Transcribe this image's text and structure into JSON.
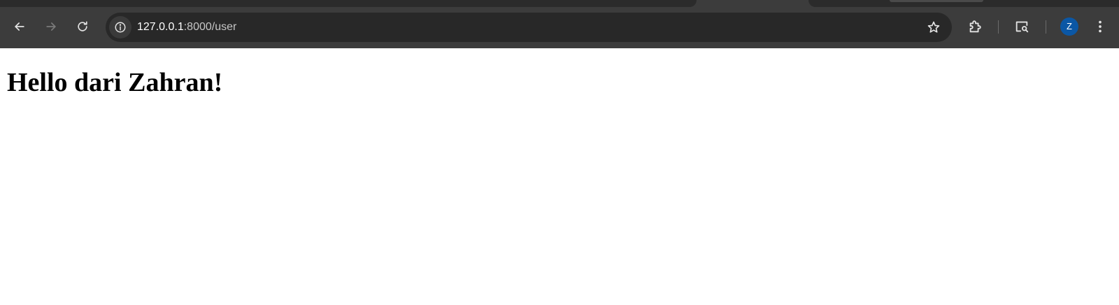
{
  "browser": {
    "url_host": "127.0.0.1",
    "url_rest": ":8000/user",
    "profile_initial": "Z",
    "icons": {
      "back": "arrow-left-icon",
      "forward": "arrow-right-icon",
      "reload": "reload-icon",
      "site_info": "info-icon",
      "bookmark": "star-icon",
      "extensions": "puzzle-icon",
      "cast": "cast-search-icon",
      "menu": "kebab-menu-icon"
    },
    "colors": {
      "toolbar": "#3c3c3c",
      "omnibox": "#282828",
      "avatar": "#0b57a5"
    }
  },
  "page": {
    "heading": "Hello dari Zahran!"
  }
}
